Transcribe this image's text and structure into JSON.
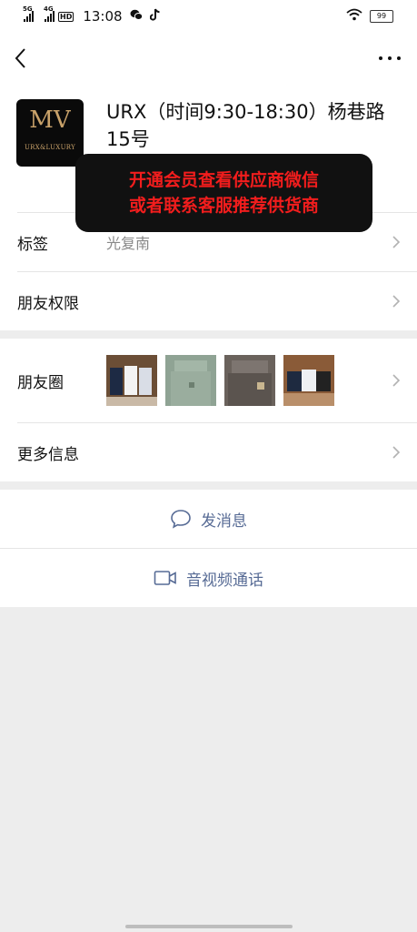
{
  "status_bar": {
    "sim1": "5G",
    "sim2": "4G",
    "hd_badge": "HD",
    "time": "13:08",
    "wifi_icon": "wifi-icon",
    "battery": "99"
  },
  "nav": {
    "back_icon": "chevron-left-icon",
    "more_icon": "more-dots-icon"
  },
  "profile": {
    "name": "URX（时间9:30-18:30）杨巷路15号",
    "avatar_monogram": "MV",
    "avatar_brand": "URX&LUXURY"
  },
  "overlay": {
    "line1": "开通会员查看供应商微信",
    "line2": "或者联系客服推荐供货商"
  },
  "info_rows": {
    "tags_label": "标签",
    "tags_value": "光复南",
    "permissions_label": "朋友权限"
  },
  "moments_rows": {
    "moments_label": "朋友圈",
    "more_info_label": "更多信息"
  },
  "actions": {
    "message_label": "发消息",
    "video_call_label": "音视频通话"
  },
  "colors": {
    "link": "#576b95",
    "banner_text": "#f21d1d",
    "background": "#ededed"
  }
}
